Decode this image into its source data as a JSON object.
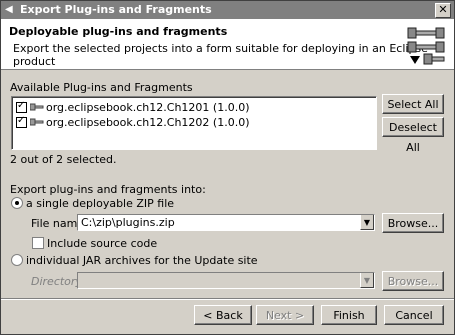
{
  "window": {
    "title": "Export Plug-ins and Fragments",
    "close_glyph": "✕"
  },
  "banner": {
    "heading": "Deployable plug-ins and fragments",
    "description": "Export the selected projects into a form suitable for deploying in an Eclipse product"
  },
  "available": {
    "label": "Available Plug-ins and Fragments",
    "items": [
      {
        "label": "org.eclipsebook.ch12.Ch1201 (1.0.0)",
        "checked": true
      },
      {
        "label": "org.eclipsebook.ch12.Ch1202 (1.0.0)",
        "checked": true
      }
    ],
    "select_all": "Select All",
    "deselect_all": "Deselect All",
    "status": "2 out of 2 selected."
  },
  "export": {
    "label": "Export plug-ins and fragments into:",
    "zip_option": "a single deployable ZIP file",
    "file_name_label": "File name:",
    "file_name_value": "C:\\zip\\plugins.zip",
    "browse": "Browse...",
    "include_source": "Include source code",
    "jar_option": "individual JAR archives for the Update site",
    "directory_label": "Directory:",
    "directory_value": "",
    "browse2": "Browse..."
  },
  "footer": {
    "back": "< Back",
    "next": "Next >",
    "finish": "Finish",
    "cancel": "Cancel"
  }
}
